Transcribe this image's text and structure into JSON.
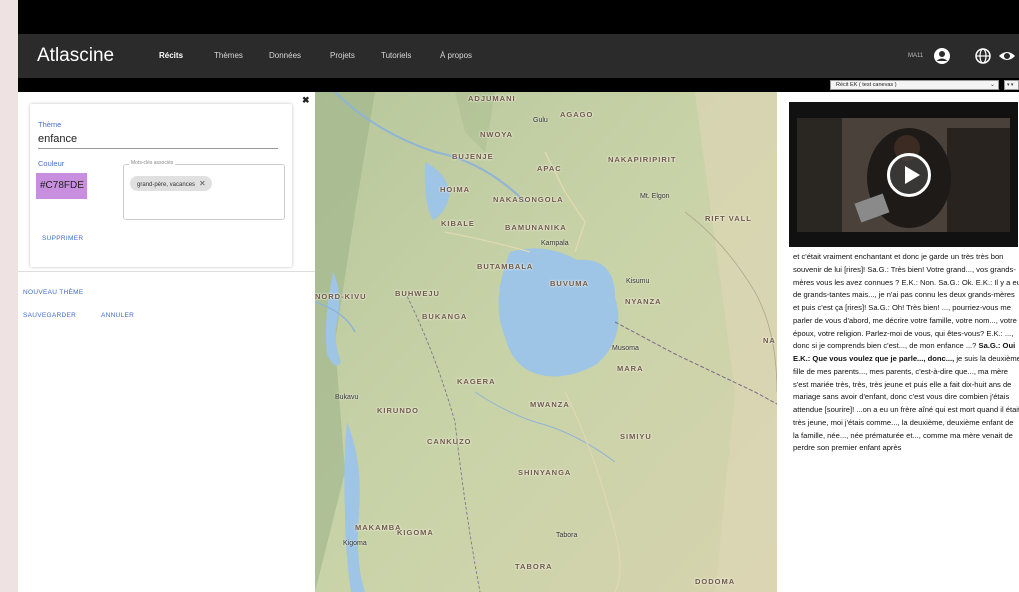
{
  "app": {
    "brand": "Atlascine",
    "nav": [
      "Récits",
      "Thèmes",
      "Données",
      "Projets",
      "Tutoriels",
      "À propos"
    ],
    "active_nav": "Récits",
    "user_label": "MA11",
    "icons": [
      "account-icon",
      "globe-icon",
      "eye-icon"
    ]
  },
  "subbar": {
    "recit_select": "Récit EK ( test canevas )",
    "side_button": "▾ ▾"
  },
  "theme_editor": {
    "close": "✖",
    "theme_label": "Thème",
    "theme_value": "enfance",
    "color_label": "Couleur",
    "color_value": "#C78FDE",
    "keywords_label": "Mots-clés associés",
    "keywords_chip": "grand-père, vacances",
    "delete_label": "SUPPRIMER"
  },
  "actions": {
    "new_theme": "NOUVEAU THÈME",
    "save": "SAUVEGARDER",
    "cancel": "ANNULER"
  },
  "map": {
    "regions": [
      "ADJUMANI",
      "AGAGO",
      "NWOYA",
      "BUJENJE",
      "APAC",
      "NAKAPIRIPIRIT",
      "HOIMA",
      "NAKASONGOLA",
      "KIBALE",
      "BAMUNANIKA",
      "RIFT VALL",
      "BUTAMBALA",
      "BUVUMA",
      "NORD-KIVU",
      "BUHWEJU",
      "BUKANGA",
      "NYANZA",
      "KAGERA",
      "MARA",
      "KIRUNDO",
      "MWANZA",
      "CANKUZO",
      "SIMIYU",
      "SHINYANGA",
      "MAKAMBA",
      "KIGOMA",
      "TABORA",
      "DODOMA",
      "NA"
    ],
    "cities": [
      "Gulu",
      "Kampala",
      "Mt. Elgon",
      "Kisumu",
      "Musoma",
      "Kigoma",
      "Tabora",
      "Bukavu"
    ]
  },
  "transcript": {
    "before_bold": "et c'était vraiment enchantant et donc je garde un très très bon souvenir de lui [rires]! Sa.G.: Très bien! Votre grand..., vos grands-mères vous les avez connues ? E.K.: Non. Sa.G.: Ok. E.K.: Il y a eu de grands-tantes mais..., je n'ai pas connu les deux grands-mères et puis c'est ça [rires]! Sa.G.: Oh! Très bien! ..., pourriez-vous me parler de vous d'abord, me décrire votre famille, votre nom..., votre époux, votre religion. Parlez-moi de vous, qui êtes-vous? E.K.: ..., donc si je comprends bien c'est..., de mon enfance ...? ",
    "bold": "Sa.G.: Oui E.K.: Que vous voulez que je parle..., donc...,",
    "after_bold": " je suis la deuxième fille de mes parents..., mes parents, c'est-à-dire que..., ma mère s'est mariée très, très, très jeune et puis elle a fait dix-huit ans de mariage sans avoir d'enfant, donc c'est vous dire combien j'étais attendue [sourire]! ...on a eu un frère aîné qui est mort quand il était très jeune, moi j'étais comme..., la deuxième, deuxième enfant de la famille, née..., née prématurée et..., comme ma mère venait de perdre son premier enfant après"
  }
}
